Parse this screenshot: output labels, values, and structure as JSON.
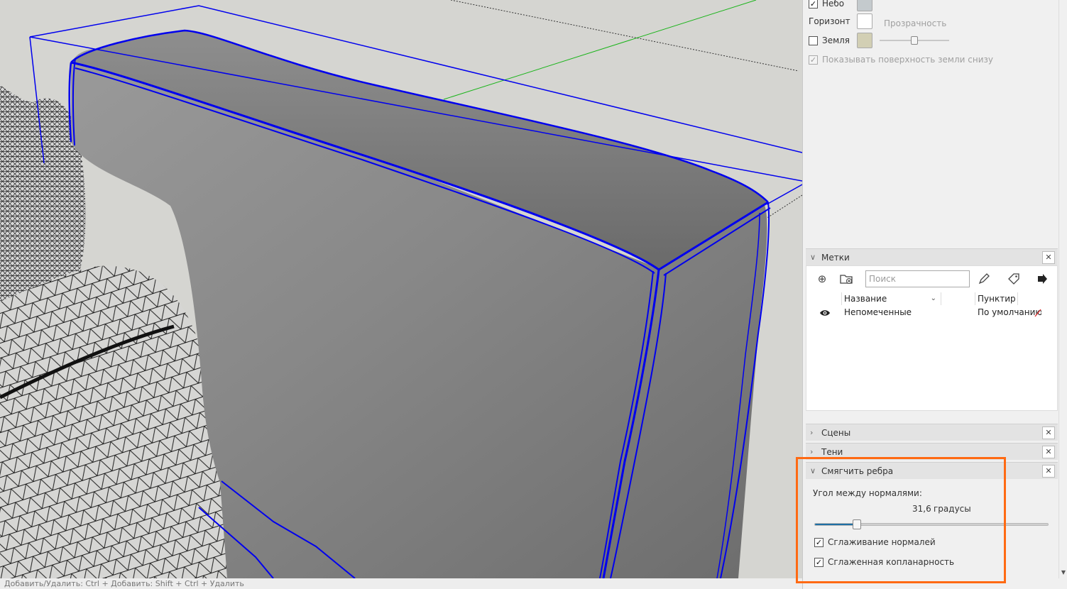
{
  "colors": {
    "accent_highlight": "#ff6a13",
    "selection_blue": "#0000ee",
    "axis_green": "#19b419",
    "slider_fill": "#1f6fa5",
    "sky_swatch": "#c4cacd",
    "horizon_swatch": "#ffffff",
    "ground_swatch": "#d2cfb4"
  },
  "styles_panel": {
    "sky_label": "Небо",
    "horizon_label": "Горизонт",
    "ground_label": "Земля",
    "transparency_label": "Прозрачность",
    "show_ground_below_label": "Показывать поверхность земли снизу",
    "sky_checked": true,
    "ground_checked": false,
    "show_ground_below_checked": true
  },
  "tags_panel": {
    "title": "Метки",
    "search_placeholder": "Поиск",
    "tool_icons": [
      "add-tag-icon",
      "add-tag-folder-icon",
      "pencil-icon",
      "tag-color-icon",
      "details-arrow-icon"
    ],
    "columns": {
      "name": "Название",
      "dash": "Пунктир"
    },
    "rows": [
      {
        "visible_icon": "eye-icon",
        "name": "Непомеченные",
        "dash": "По умолчанию"
      }
    ]
  },
  "collapsed_panels": [
    {
      "title": "Сцены"
    },
    {
      "title": "Тени"
    }
  ],
  "soften_panel": {
    "title": "Смягчить ребра",
    "angle_label": "Угол между нормалями:",
    "angle_value": "31,6",
    "angle_unit": "градусы",
    "angle_fraction": 0.18,
    "smooth_normals_label": "Сглаживание нормалей",
    "smooth_normals_checked": true,
    "soften_coplanar_label": "Сглаженная копланарность",
    "soften_coplanar_checked": true
  },
  "status_bar": {
    "text": "Добавить/Удалить: Ctrl + Добавить: Shift + Ctrl + Удалить"
  }
}
